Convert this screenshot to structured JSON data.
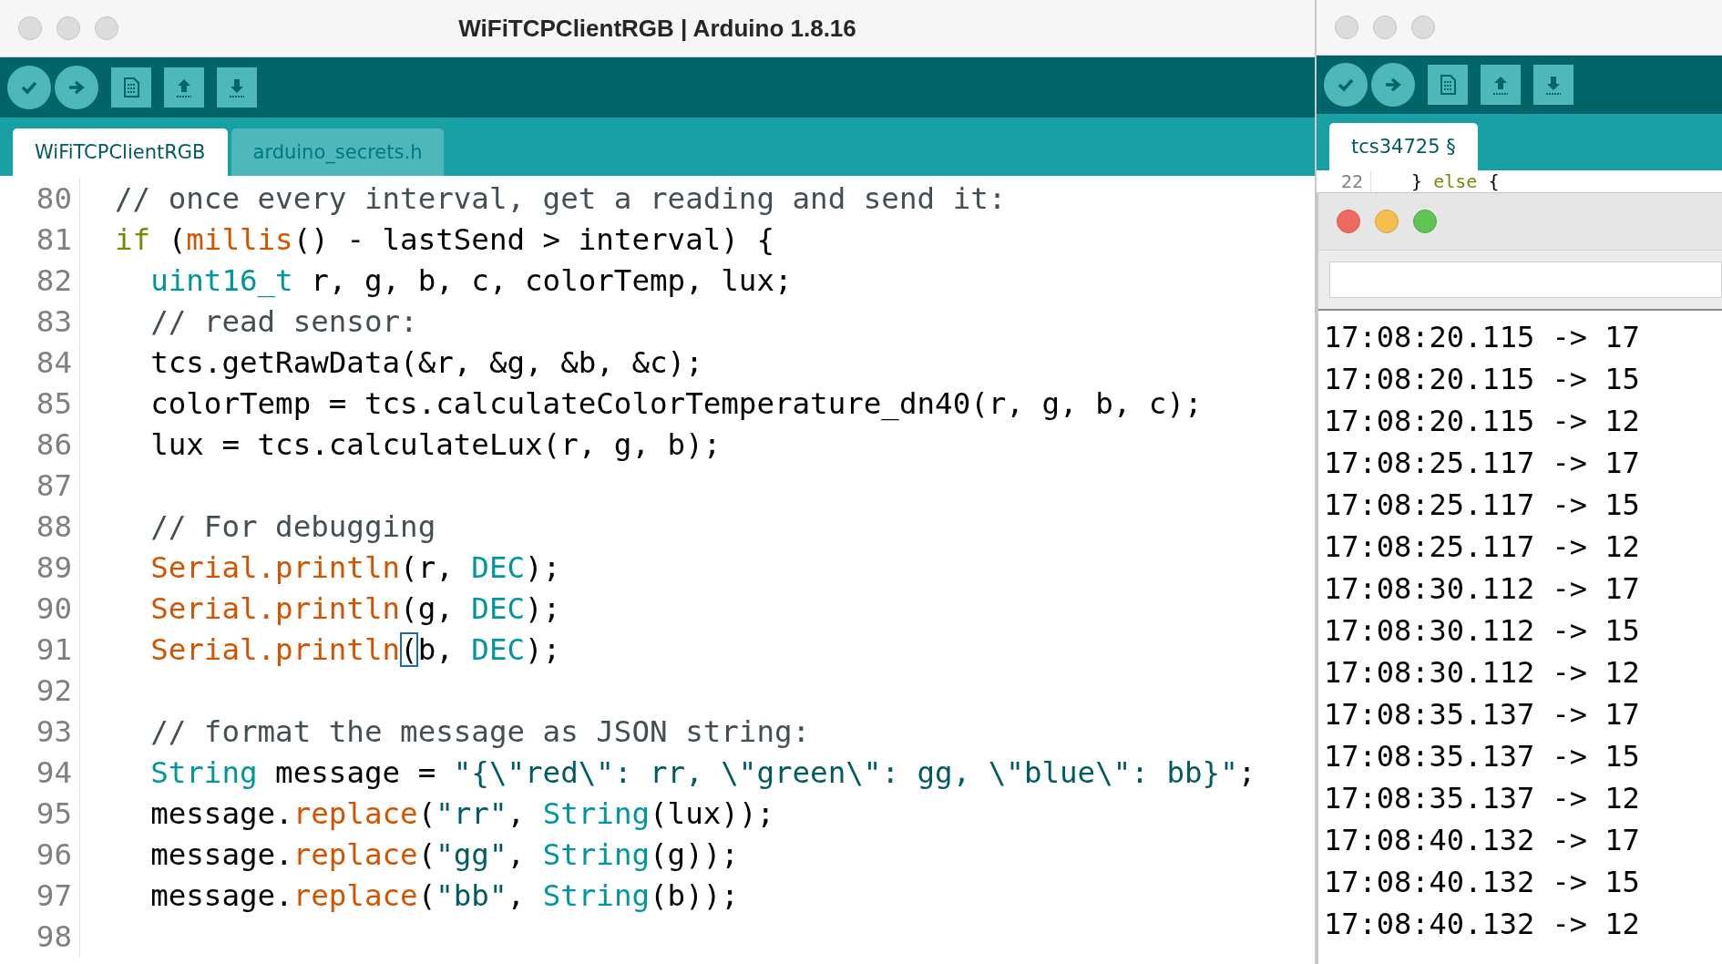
{
  "editor_window": {
    "title": "WiFiTCPClientRGB | Arduino 1.8.16",
    "active": false,
    "tabs": [
      {
        "label": "WiFiTCPClientRGB",
        "selected": true
      },
      {
        "label": "arduino_secrets.h",
        "selected": false
      }
    ],
    "lines": [
      {
        "number": "80",
        "tokens": [
          {
            "kind": "comment",
            "text": "// once every interval, get a reading and send it:"
          }
        ]
      },
      {
        "number": "81",
        "tokens": [
          {
            "kind": "keyword",
            "text": "if"
          },
          {
            "kind": "plain",
            "text": " ("
          },
          {
            "kind": "function",
            "text": "millis"
          },
          {
            "kind": "plain",
            "text": "() - lastSend > interval) {"
          }
        ]
      },
      {
        "number": "82",
        "tokens": [
          {
            "kind": "type",
            "text": "  uint16_t"
          },
          {
            "kind": "plain",
            "text": " r, g, b, c, colorTemp, lux;"
          }
        ]
      },
      {
        "number": "83",
        "tokens": [
          {
            "kind": "comment",
            "text": "  // read sensor:"
          }
        ]
      },
      {
        "number": "84",
        "tokens": [
          {
            "kind": "plain",
            "text": "  tcs.getRawData(&r, &g, &b, &c);"
          }
        ]
      },
      {
        "number": "85",
        "tokens": [
          {
            "kind": "plain",
            "text": "  colorTemp = tcs.calculateColorTemperature_dn40(r, g, b, c);"
          }
        ]
      },
      {
        "number": "86",
        "tokens": [
          {
            "kind": "plain",
            "text": "  lux = tcs.calculateLux(r, g, b);"
          }
        ]
      },
      {
        "number": "87"
      },
      {
        "number": "88",
        "tokens": [
          {
            "kind": "comment",
            "text": "  // For debugging"
          }
        ]
      },
      {
        "number": "89",
        "tokens": [
          {
            "kind": "function",
            "text": "  Serial.println"
          },
          {
            "kind": "plain",
            "text": "(r, "
          },
          {
            "kind": "type",
            "text": "DEC"
          },
          {
            "kind": "plain",
            "text": ");"
          }
        ]
      },
      {
        "number": "90",
        "tokens": [
          {
            "kind": "function",
            "text": "  Serial.println"
          },
          {
            "kind": "plain",
            "text": "(g, "
          },
          {
            "kind": "type",
            "text": "DEC"
          },
          {
            "kind": "plain",
            "text": ");"
          }
        ]
      },
      {
        "number": "91",
        "tokens": [
          {
            "kind": "function",
            "text": "  Serial.println"
          },
          {
            "kind": "match",
            "text": "("
          },
          {
            "kind": "plain",
            "text": "b, "
          },
          {
            "kind": "type",
            "text": "DEC"
          },
          {
            "kind": "plain",
            "text": ");"
          }
        ]
      },
      {
        "number": "92"
      },
      {
        "number": "93",
        "tokens": [
          {
            "kind": "comment",
            "text": "  // format the message as JSON string:"
          }
        ]
      },
      {
        "number": "94",
        "tokens": [
          {
            "kind": "type",
            "text": "  String"
          },
          {
            "kind": "plain",
            "text": " message = "
          },
          {
            "kind": "string",
            "text": "\"{\\\"red\\\": rr, \\\"green\\\": gg, \\\"blue\\\": bb}\""
          },
          {
            "kind": "plain",
            "text": ";"
          }
        ]
      },
      {
        "number": "95",
        "tokens": [
          {
            "kind": "plain",
            "text": "  message."
          },
          {
            "kind": "function",
            "text": "replace"
          },
          {
            "kind": "plain",
            "text": "("
          },
          {
            "kind": "string",
            "text": "\"rr\""
          },
          {
            "kind": "plain",
            "text": ", "
          },
          {
            "kind": "type",
            "text": "String"
          },
          {
            "kind": "plain",
            "text": "(lux));"
          }
        ]
      },
      {
        "number": "96",
        "tokens": [
          {
            "kind": "plain",
            "text": "  message."
          },
          {
            "kind": "function",
            "text": "replace"
          },
          {
            "kind": "plain",
            "text": "("
          },
          {
            "kind": "string",
            "text": "\"gg\""
          },
          {
            "kind": "plain",
            "text": ", "
          },
          {
            "kind": "type",
            "text": "String"
          },
          {
            "kind": "plain",
            "text": "(g));"
          }
        ]
      },
      {
        "number": "97",
        "tokens": [
          {
            "kind": "plain",
            "text": "  message."
          },
          {
            "kind": "function",
            "text": "replace"
          },
          {
            "kind": "plain",
            "text": "("
          },
          {
            "kind": "string",
            "text": "\"bb\""
          },
          {
            "kind": "plain",
            "text": ", "
          },
          {
            "kind": "type",
            "text": "String"
          },
          {
            "kind": "plain",
            "text": "(b));"
          }
        ]
      },
      {
        "number": "98"
      }
    ]
  },
  "second_window": {
    "active": false,
    "tabs": [
      {
        "label": "tcs34725 §",
        "selected": true
      }
    ],
    "lines": [
      {
        "number": "22",
        "tokens": [
          {
            "kind": "plain",
            "text": "  } "
          },
          {
            "kind": "keyword",
            "text": "else"
          },
          {
            "kind": "plain",
            "text": " {"
          }
        ]
      }
    ]
  },
  "serial_monitor": {
    "active": true,
    "output": [
      "17:08:20.115 -> 17",
      "17:08:20.115 -> 15",
      "17:08:20.115 -> 12",
      "17:08:25.117 -> 17",
      "17:08:25.117 -> 15",
      "17:08:25.117 -> 12",
      "17:08:30.112 -> 17",
      "17:08:30.112 -> 15",
      "17:08:30.112 -> 12",
      "17:08:35.137 -> 17",
      "17:08:35.137 -> 15",
      "17:08:35.137 -> 12",
      "17:08:40.132 -> 17",
      "17:08:40.132 -> 15",
      "17:08:40.132 -> 12"
    ]
  }
}
